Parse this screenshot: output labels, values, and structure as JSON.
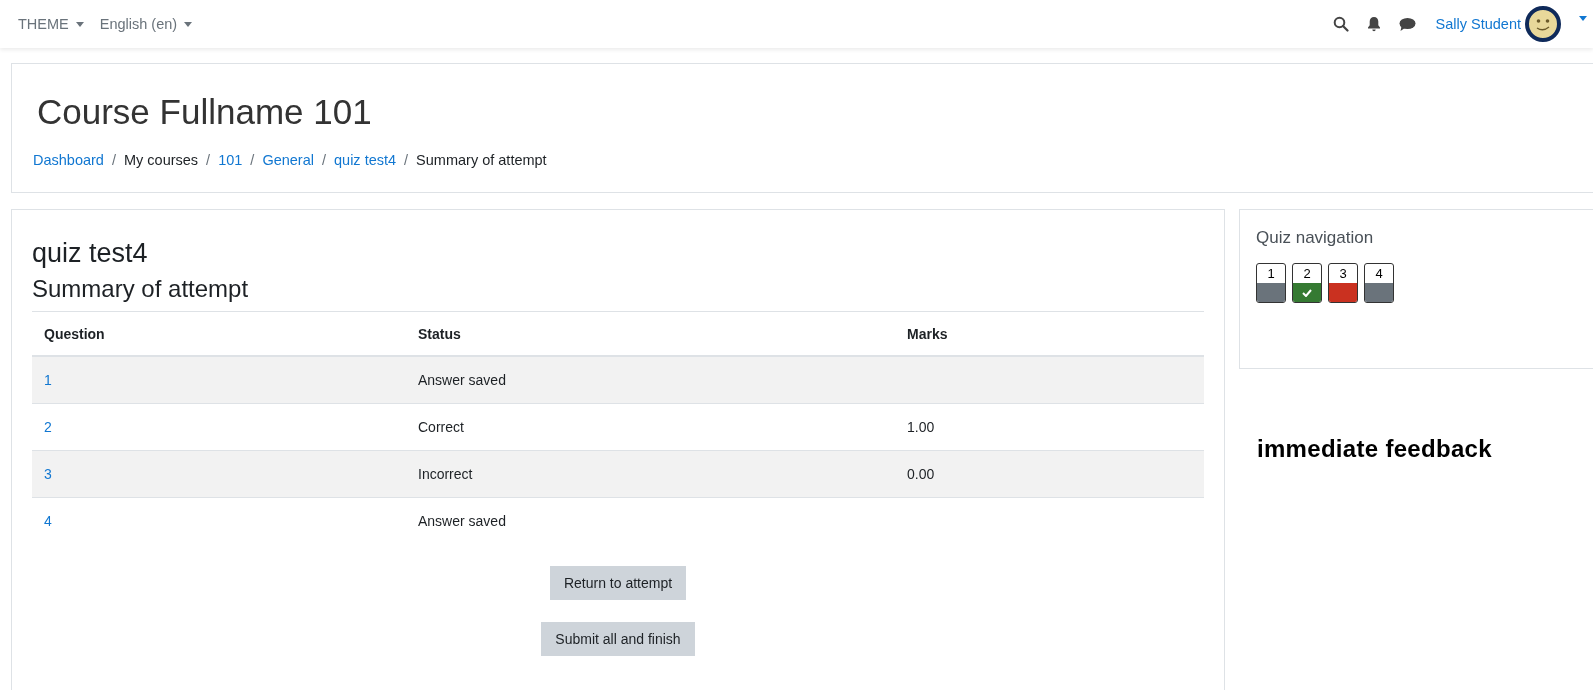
{
  "navbar": {
    "menus": [
      {
        "label": "THEME"
      },
      {
        "label": "English (en)"
      }
    ],
    "user_name": "Sally Student"
  },
  "header": {
    "title": "Course Fullname 101",
    "breadcrumb": [
      {
        "label": "Dashboard",
        "kind": "link"
      },
      {
        "separator": "/",
        "label": "My courses",
        "kind": "text"
      },
      {
        "separator": "/",
        "label": "101",
        "kind": "link"
      },
      {
        "separator": "/",
        "label": "General",
        "kind": "link"
      },
      {
        "separator": "/",
        "label": "quiz test4",
        "kind": "link"
      },
      {
        "separator": "/",
        "label": "Summary of attempt",
        "kind": "text"
      }
    ]
  },
  "main": {
    "title": "quiz test4",
    "subtitle": "Summary of attempt",
    "table": {
      "columns": [
        "Question",
        "Status",
        "Marks"
      ],
      "rows": [
        {
          "question": "1",
          "status": "Answer saved"
        },
        {
          "question": "2",
          "status": "Correct",
          "marks": "1.00"
        },
        {
          "question": "3",
          "status": "Incorrect",
          "marks": "0.00"
        },
        {
          "question": "4",
          "status": "Answer saved"
        }
      ]
    },
    "buttons": [
      "Return to attempt",
      "Submit all and finish"
    ]
  },
  "quiz_navigation": {
    "title": "Quiz navigation",
    "questions": [
      {
        "label": "1",
        "kind": "answered"
      },
      {
        "label": "2",
        "kind": "correct"
      },
      {
        "label": "3",
        "kind": "incorrect"
      },
      {
        "label": "4",
        "kind": "answered"
      }
    ]
  },
  "side_note": "immediate feedback"
}
